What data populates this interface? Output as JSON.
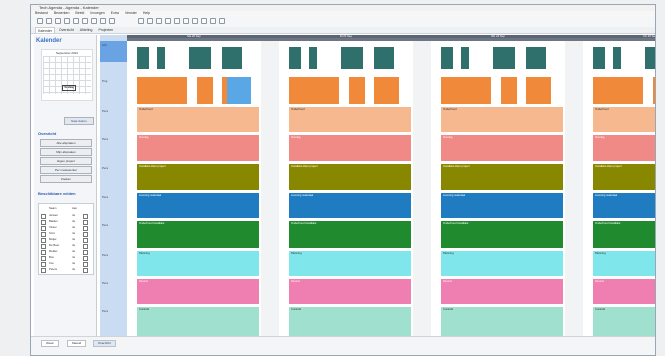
{
  "window": {
    "title": "Tech Agenda - Agenda - Kalender",
    "menu": [
      "Bestand",
      "Bewerken",
      "Beeld",
      "Invoegen",
      "Extra",
      "Venster",
      "Help"
    ],
    "tabs": [
      {
        "label": "Kalender",
        "active": true
      },
      {
        "label": "Overzicht",
        "active": false
      },
      {
        "label": "Afdeling",
        "active": false
      },
      {
        "label": "Projecten",
        "active": false
      }
    ]
  },
  "sidebar": {
    "title": "Kalender",
    "month_header": "September 2021",
    "today_label": "Vandaag",
    "link_label": "Naar datum",
    "section_1": "Overzicht",
    "buttons": [
      "Alle afspraken",
      "Mijn afspraken",
      "Eigen project",
      "Per medewerker",
      "Zoeken"
    ],
    "section_2": "Beschikbare velden",
    "fields_header": {
      "name": "Naam",
      "value": "Aan"
    },
    "fields": [
      {
        "name": "Jansen",
        "value": "Ja"
      },
      {
        "name": "Bakker",
        "value": "Ja"
      },
      {
        "name": "Visser",
        "value": "Ja"
      },
      {
        "name": "Smit",
        "value": "Ja"
      },
      {
        "name": "Meijer",
        "value": "Ja"
      },
      {
        "name": "De Boer",
        "value": "Ja"
      },
      {
        "name": "Mulder",
        "value": "Ja"
      },
      {
        "name": "Bos",
        "value": "Ja"
      },
      {
        "name": "Vos",
        "value": "Ja"
      },
      {
        "name": "Peters",
        "value": "Ja"
      }
    ]
  },
  "grid": {
    "day_headers": [
      "Ma 20 Sep",
      "Di 21 Sep",
      "Wo 22 Sep",
      "Do 23 Sep"
    ],
    "lanes": [
      {
        "label": "Afd",
        "color": "#2f6f6c"
      },
      {
        "label": "Proj",
        "color": "#f08a3a"
      },
      {
        "label": "Pers",
        "color": "#f6b88f"
      },
      {
        "label": "Pers",
        "color": "#f08a86"
      },
      {
        "label": "Pers",
        "color": "#888800"
      },
      {
        "label": "Pers",
        "color": "#1f7cc0"
      },
      {
        "label": "Pers",
        "color": "#1f8a2e"
      },
      {
        "label": "Pers",
        "color": "#7fe6ec"
      },
      {
        "label": "Pers",
        "color": "#f07fb1"
      },
      {
        "label": "Pers",
        "color": "#9fe0cf"
      }
    ],
    "band_text": [
      "Onderhoud",
      "Overleg",
      "Installatie klant project",
      "Levering materiaal",
      "Onderhoud installatie",
      "Planning",
      "Service",
      "Controle",
      "Project"
    ]
  },
  "footer": {
    "tabs": [
      "Week",
      "Maand",
      "Overzicht"
    ],
    "active": "Overzicht"
  }
}
